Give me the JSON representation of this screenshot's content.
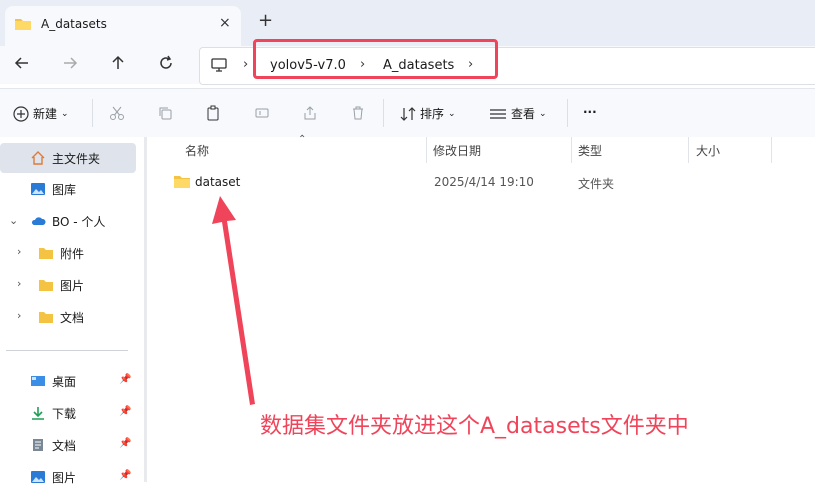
{
  "tab": {
    "title": "A_datasets",
    "close_icon": "×",
    "new_tab_icon": "+"
  },
  "breadcrumb": {
    "items": [
      "yolov5-v7.0",
      "A_datasets"
    ]
  },
  "toolbar": {
    "new_label": "新建",
    "sort_label": "排序",
    "view_label": "查看",
    "more_label": "···"
  },
  "sidebar": {
    "home": "主文件夹",
    "gallery": "图库",
    "cloud": "BO - 个人",
    "cloud_children": [
      "附件",
      "图片",
      "文档"
    ],
    "quick_access": [
      "桌面",
      "下载",
      "文档",
      "图片"
    ]
  },
  "columns": {
    "name": "名称",
    "modified": "修改日期",
    "type": "类型",
    "size": "大小"
  },
  "files": [
    {
      "name": "dataset",
      "modified": "2025/4/14 19:10",
      "type": "文件夹",
      "size": ""
    }
  ],
  "annotation": {
    "text": "数据集文件夹放进这个A_datasets文件夹中"
  },
  "colors": {
    "accent": "#f0445a",
    "folder": "#f5c342",
    "selected": "#dfe4ec"
  }
}
